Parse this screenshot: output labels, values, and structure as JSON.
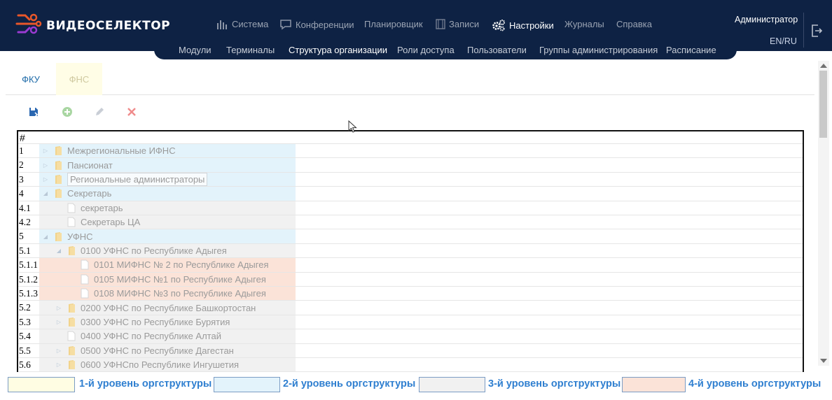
{
  "brand": {
    "name": "ВИДЕОСЕЛЕКТОР"
  },
  "nav": [
    {
      "label": "Система",
      "icon": "chart-bars-icon",
      "active": false
    },
    {
      "label": "Конференции",
      "icon": "chat-bubble-icon",
      "active": false
    },
    {
      "label": "Планировщик",
      "icon": "",
      "active": false
    },
    {
      "label": "Записи",
      "icon": "film-icon",
      "active": false
    },
    {
      "label": "Настройки",
      "icon": "gears-icon",
      "active": true
    },
    {
      "label": "Журналы",
      "icon": "",
      "active": false
    },
    {
      "label": "Справка",
      "icon": "",
      "active": false
    }
  ],
  "subnav": [
    {
      "label": "Модули",
      "active": false
    },
    {
      "label": "Терминалы",
      "active": false
    },
    {
      "label": "Структура организации",
      "active": true
    },
    {
      "label": "Роли доступа",
      "active": false
    },
    {
      "label": "Пользователи",
      "active": false
    },
    {
      "label": "Группы администрирования",
      "active": false
    },
    {
      "label": "Расписание",
      "active": false
    }
  ],
  "user": {
    "name": "Администратор",
    "lang": "EN/RU"
  },
  "tabs": [
    {
      "label": "ФКУ",
      "active": false
    },
    {
      "label": "ФНС",
      "active": true
    }
  ],
  "toolbar": {
    "save": "save-icon",
    "add": "add-icon",
    "edit": "edit-icon",
    "delete": "delete-icon"
  },
  "grid": {
    "header": "#",
    "rows": [
      {
        "num": "1",
        "label": "Межрегиональные ИФНС",
        "level": 2,
        "depth": 0,
        "type": "folder",
        "expanded": false
      },
      {
        "num": "2",
        "label": "Пансионат",
        "level": 2,
        "depth": 0,
        "type": "folder",
        "expanded": false
      },
      {
        "num": "3",
        "label": "Региональные администраторы",
        "level": 2,
        "depth": 0,
        "type": "folder",
        "expanded": false,
        "selected": true
      },
      {
        "num": "4",
        "label": "Секретарь",
        "level": 2,
        "depth": 0,
        "type": "folder",
        "expanded": true
      },
      {
        "num": "4.1",
        "label": "секретарь",
        "level": 3,
        "depth": 1,
        "type": "file"
      },
      {
        "num": "4.2",
        "label": "Секретарь ЦА",
        "level": 3,
        "depth": 1,
        "type": "file"
      },
      {
        "num": "5",
        "label": "УФНС",
        "level": 2,
        "depth": 0,
        "type": "folder",
        "expanded": true
      },
      {
        "num": "5.1",
        "label": "0100 УФНС по Республике Адыгея",
        "level": 3,
        "depth": 1,
        "type": "folder",
        "expanded": true
      },
      {
        "num": "5.1.1",
        "label": "0101 МИФНС № 2 по Республике Адыгея",
        "level": 4,
        "depth": 2,
        "type": "file"
      },
      {
        "num": "5.1.2",
        "label": "0105 МИФНС №1 по Республике Адыгея",
        "level": 4,
        "depth": 2,
        "type": "file"
      },
      {
        "num": "5.1.3",
        "label": "0108 МИФНС №3 по Республике Адыгея",
        "level": 4,
        "depth": 2,
        "type": "file"
      },
      {
        "num": "5.2",
        "label": "0200 УФНС по Республике Башкортостан",
        "level": 3,
        "depth": 1,
        "type": "folder",
        "expanded": false
      },
      {
        "num": "5.3",
        "label": "0300 УФНС по Республике Бурятия",
        "level": 3,
        "depth": 1,
        "type": "folder",
        "expanded": false
      },
      {
        "num": "5.4",
        "label": "0400 УФНС по Республике Алтай",
        "level": 3,
        "depth": 1,
        "type": "file"
      },
      {
        "num": "5.5",
        "label": "0500 УФНС по Республике Дагестан",
        "level": 3,
        "depth": 1,
        "type": "folder",
        "expanded": false
      },
      {
        "num": "5.6",
        "label": "0600 УФНСпо Республике Ингушетия",
        "level": 3,
        "depth": 1,
        "type": "folder",
        "expanded": false
      }
    ]
  },
  "legend": [
    {
      "label": "1-й уровень оргструктуры",
      "color": "#fffde3"
    },
    {
      "label": "2-й уровень оргструктуры",
      "color": "#e3f3fb"
    },
    {
      "label": "3-й уровень оргструктуры",
      "color": "#f1f1f1"
    },
    {
      "label": "4-й уровень оргструктуры",
      "color": "#fbe3d8"
    }
  ]
}
